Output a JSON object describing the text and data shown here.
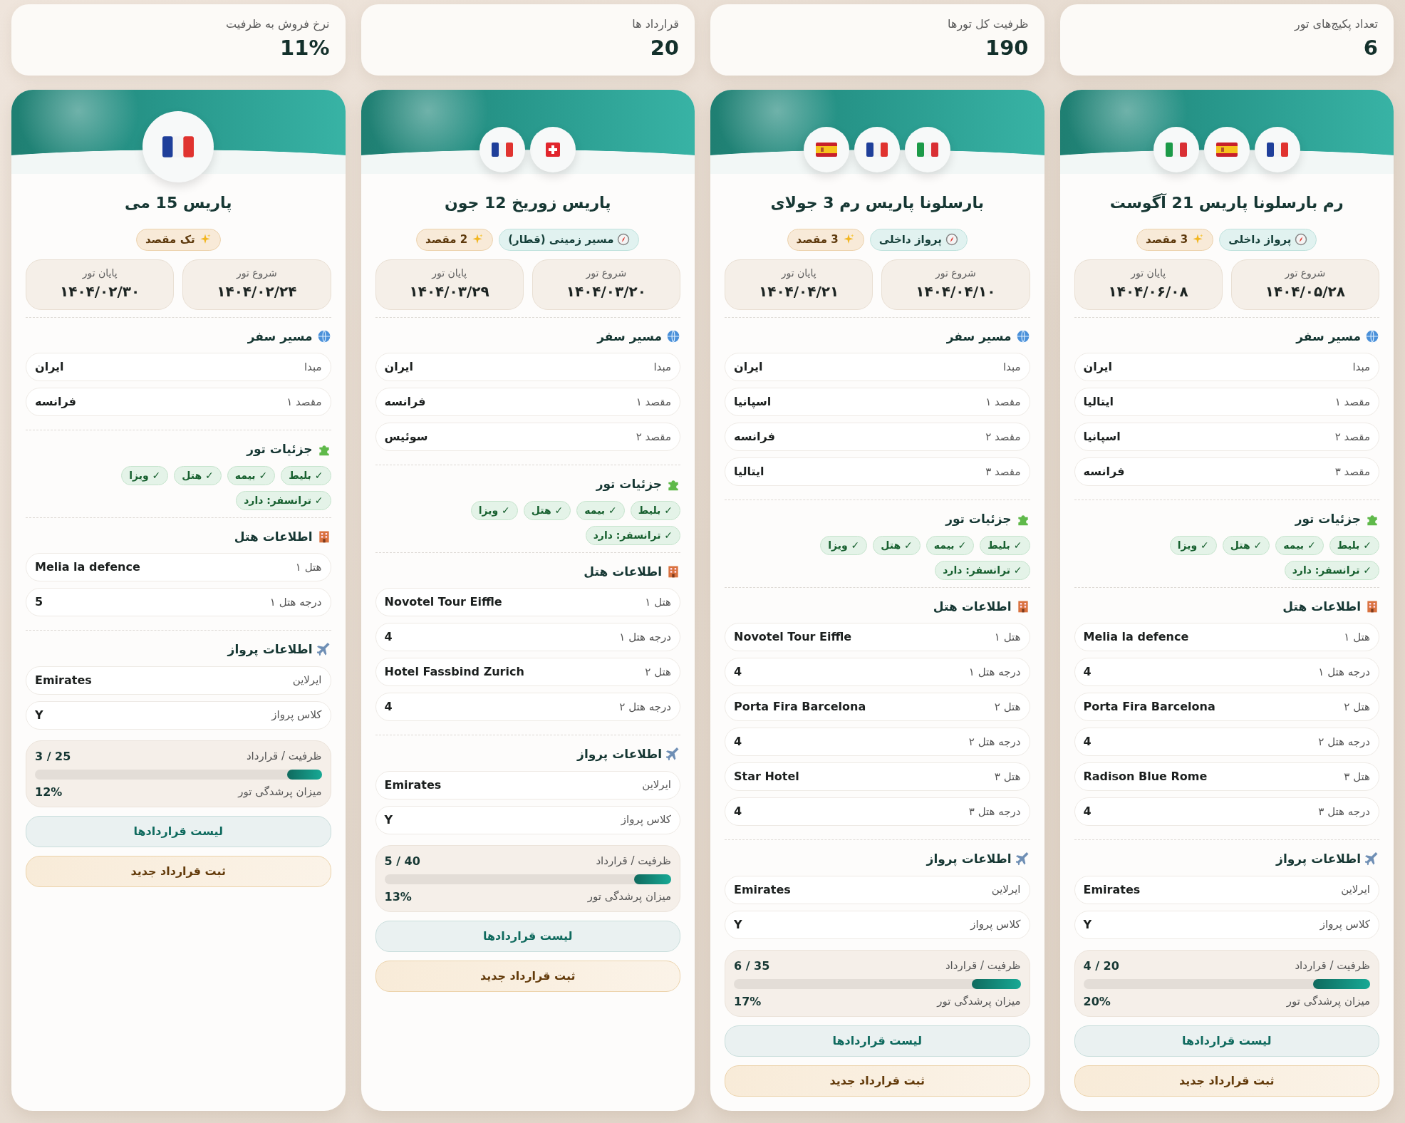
{
  "stats": [
    {
      "label": "تعداد پکیج‌های تور",
      "value": "6"
    },
    {
      "label": "ظرفیت کل تورها",
      "value": "190"
    },
    {
      "label": "قرارداد ها",
      "value": "20"
    },
    {
      "label": "نرخ فروش به ظرفیت",
      "value": "11%"
    }
  ],
  "cards": [
    {
      "flags": [
        {
          "kind": "fr"
        },
        {
          "kind": "es"
        },
        {
          "kind": "it"
        }
      ],
      "title": "رم بارسلونا پاریس 21 آگوست",
      "badges": [
        {
          "kind": "route",
          "text": "پرواز داخلی"
        },
        {
          "kind": "count",
          "text": "3 مقصد"
        }
      ],
      "dates": [
        {
          "label": "شروع تور",
          "value": "۱۴۰۴/۰۵/۲۸"
        },
        {
          "label": "پایان تور",
          "value": "۱۴۰۴/۰۶/۰۸"
        }
      ],
      "sections": [
        {
          "kind": "route",
          "title": "مسیر سفر",
          "rows": [
            {
              "label": "مبدا",
              "value": "ایران"
            },
            {
              "label": "مقصد ۱",
              "value": "ایتالیا"
            },
            {
              "label": "مقصد ۲",
              "value": "اسپانیا"
            },
            {
              "label": "مقصد ۳",
              "value": "فرانسه"
            }
          ]
        },
        {
          "kind": "services",
          "title": "جزئیات تور",
          "chips": [
            "✓ بلیط",
            "✓ بیمه",
            "✓ هتل",
            "✓ ویزا",
            "✓ ترانسفر: دارد"
          ]
        },
        {
          "kind": "hotel",
          "title": "اطلاعات هتل",
          "rows": [
            {
              "label": "هتل ۱",
              "value": "Melia la defence"
            },
            {
              "label": "درجه هتل ۱",
              "value": "4"
            },
            {
              "label": "هتل ۲",
              "value": "Porta Fira Barcelona"
            },
            {
              "label": "درجه هتل ۲",
              "value": "4"
            },
            {
              "label": "هتل ۳",
              "value": "Radison Blue Rome"
            },
            {
              "label": "درجه هتل ۳",
              "value": "4"
            }
          ]
        },
        {
          "kind": "flight",
          "title": "اطلاعات پرواز",
          "rows": [
            {
              "label": "ایرلاین",
              "value": "Emirates"
            },
            {
              "label": "کلاس پرواز",
              "value": "Y"
            }
          ]
        }
      ],
      "capacity": {
        "label": "ظرفیت / قرارداد",
        "value": "4 / 20",
        "fill_label": "میزان پرشدگی تور",
        "percent": "20%",
        "level": 0.2
      },
      "buttons": [
        {
          "kind": "list",
          "label": "لیست قراردادها"
        },
        {
          "kind": "new",
          "label": "ثبت قرارداد جدید"
        }
      ]
    },
    {
      "flags": [
        {
          "kind": "it"
        },
        {
          "kind": "fr"
        },
        {
          "kind": "es"
        }
      ],
      "title": "بارسلونا پاریس رم 3 جولای",
      "badges": [
        {
          "kind": "route",
          "text": "پرواز داخلی"
        },
        {
          "kind": "count",
          "text": "3 مقصد"
        }
      ],
      "dates": [
        {
          "label": "شروع تور",
          "value": "۱۴۰۴/۰۴/۱۰"
        },
        {
          "label": "پایان تور",
          "value": "۱۴۰۴/۰۴/۲۱"
        }
      ],
      "sections": [
        {
          "kind": "route",
          "title": "مسیر سفر",
          "rows": [
            {
              "label": "مبدا",
              "value": "ایران"
            },
            {
              "label": "مقصد ۱",
              "value": "اسپانیا"
            },
            {
              "label": "مقصد ۲",
              "value": "فرانسه"
            },
            {
              "label": "مقصد ۳",
              "value": "ایتالیا"
            }
          ]
        },
        {
          "kind": "services",
          "title": "جزئیات تور",
          "chips": [
            "✓ بلیط",
            "✓ بیمه",
            "✓ هتل",
            "✓ ویزا",
            "✓ ترانسفر: دارد"
          ]
        },
        {
          "kind": "hotel",
          "title": "اطلاعات هتل",
          "rows": [
            {
              "label": "هتل ۱",
              "value": "Novotel Tour Eiffle"
            },
            {
              "label": "درجه هتل ۱",
              "value": "4"
            },
            {
              "label": "هتل ۲",
              "value": "Porta Fira Barcelona"
            },
            {
              "label": "درجه هتل ۲",
              "value": "4"
            },
            {
              "label": "هتل ۳",
              "value": "Star Hotel"
            },
            {
              "label": "درجه هتل ۳",
              "value": "4"
            }
          ]
        },
        {
          "kind": "flight",
          "title": "اطلاعات پرواز",
          "rows": [
            {
              "label": "ایرلاین",
              "value": "Emirates"
            },
            {
              "label": "کلاس پرواز",
              "value": "Y"
            }
          ]
        }
      ],
      "capacity": {
        "label": "ظرفیت / قرارداد",
        "value": "6 / 35",
        "fill_label": "میزان پرشدگی تور",
        "percent": "17%",
        "level": 0.17
      },
      "buttons": [
        {
          "kind": "list",
          "label": "لیست قراردادها"
        },
        {
          "kind": "new",
          "label": "ثبت قرارداد جدید"
        }
      ]
    },
    {
      "flags": [
        {
          "kind": "ch"
        },
        {
          "kind": "fr"
        }
      ],
      "title": "پاریس زوریخ 12 جون",
      "badges": [
        {
          "kind": "route",
          "text": "مسیر زمینی (قطار)"
        },
        {
          "kind": "count",
          "text": "2 مقصد"
        }
      ],
      "dates": [
        {
          "label": "شروع تور",
          "value": "۱۴۰۴/۰۳/۲۰"
        },
        {
          "label": "پایان تور",
          "value": "۱۴۰۴/۰۳/۲۹"
        }
      ],
      "sections": [
        {
          "kind": "route",
          "title": "مسیر سفر",
          "rows": [
            {
              "label": "مبدا",
              "value": "ایران"
            },
            {
              "label": "مقصد ۱",
              "value": "فرانسه"
            },
            {
              "label": "مقصد ۲",
              "value": "سوئیس"
            }
          ]
        },
        {
          "kind": "services",
          "title": "جزئیات تور",
          "chips": [
            "✓ بلیط",
            "✓ بیمه",
            "✓ هتل",
            "✓ ویزا",
            "✓ ترانسفر: دارد"
          ]
        },
        {
          "kind": "hotel",
          "title": "اطلاعات هتل",
          "rows": [
            {
              "label": "هتل ۱",
              "value": "Novotel Tour Eiffle"
            },
            {
              "label": "درجه هتل ۱",
              "value": "4"
            },
            {
              "label": "هتل ۲",
              "value": "Hotel Fassbind Zurich"
            },
            {
              "label": "درجه هتل ۲",
              "value": "4"
            }
          ]
        },
        {
          "kind": "flight",
          "title": "اطلاعات پرواز",
          "rows": [
            {
              "label": "ایرلاین",
              "value": "Emirates"
            },
            {
              "label": "کلاس پرواز",
              "value": "Y"
            }
          ]
        }
      ],
      "capacity": {
        "label": "ظرفیت / قرارداد",
        "value": "5 / 40",
        "fill_label": "میزان پرشدگی تور",
        "percent": "13%",
        "level": 0.13
      },
      "buttons": [
        {
          "kind": "list",
          "label": "لیست قراردادها"
        },
        {
          "kind": "new",
          "label": "ثبت قرارداد جدید"
        }
      ]
    },
    {
      "flags": [
        {
          "kind": "fr"
        }
      ],
      "title": "پاریس 15 می",
      "badges": [
        {
          "kind": "count",
          "text": "تک مقصد"
        }
      ],
      "dates": [
        {
          "label": "شروع تور",
          "value": "۱۴۰۴/۰۲/۲۴"
        },
        {
          "label": "پایان تور",
          "value": "۱۴۰۴/۰۲/۳۰"
        }
      ],
      "sections": [
        {
          "kind": "route",
          "title": "مسیر سفر",
          "rows": [
            {
              "label": "مبدا",
              "value": "ایران"
            },
            {
              "label": "مقصد ۱",
              "value": "فرانسه"
            }
          ]
        },
        {
          "kind": "services",
          "title": "جزئیات تور",
          "chips": [
            "✓ بلیط",
            "✓ بیمه",
            "✓ هتل",
            "✓ ویزا",
            "✓ ترانسفر: دارد"
          ]
        },
        {
          "kind": "hotel",
          "title": "اطلاعات هتل",
          "rows": [
            {
              "label": "هتل ۱",
              "value": "Melia la defence"
            },
            {
              "label": "درجه هتل ۱",
              "value": "5"
            }
          ]
        },
        {
          "kind": "flight",
          "title": "اطلاعات پرواز",
          "rows": [
            {
              "label": "ایرلاین",
              "value": "Emirates"
            },
            {
              "label": "کلاس پرواز",
              "value": "Y"
            }
          ]
        }
      ],
      "capacity": {
        "label": "ظرفیت / قرارداد",
        "value": "3 / 25",
        "fill_label": "میزان پرشدگی تور",
        "percent": "12%",
        "level": 0.12
      },
      "buttons": [
        {
          "kind": "list",
          "label": "لیست قراردادها"
        },
        {
          "kind": "new",
          "label": "ثبت قرارداد جدید"
        }
      ]
    }
  ]
}
